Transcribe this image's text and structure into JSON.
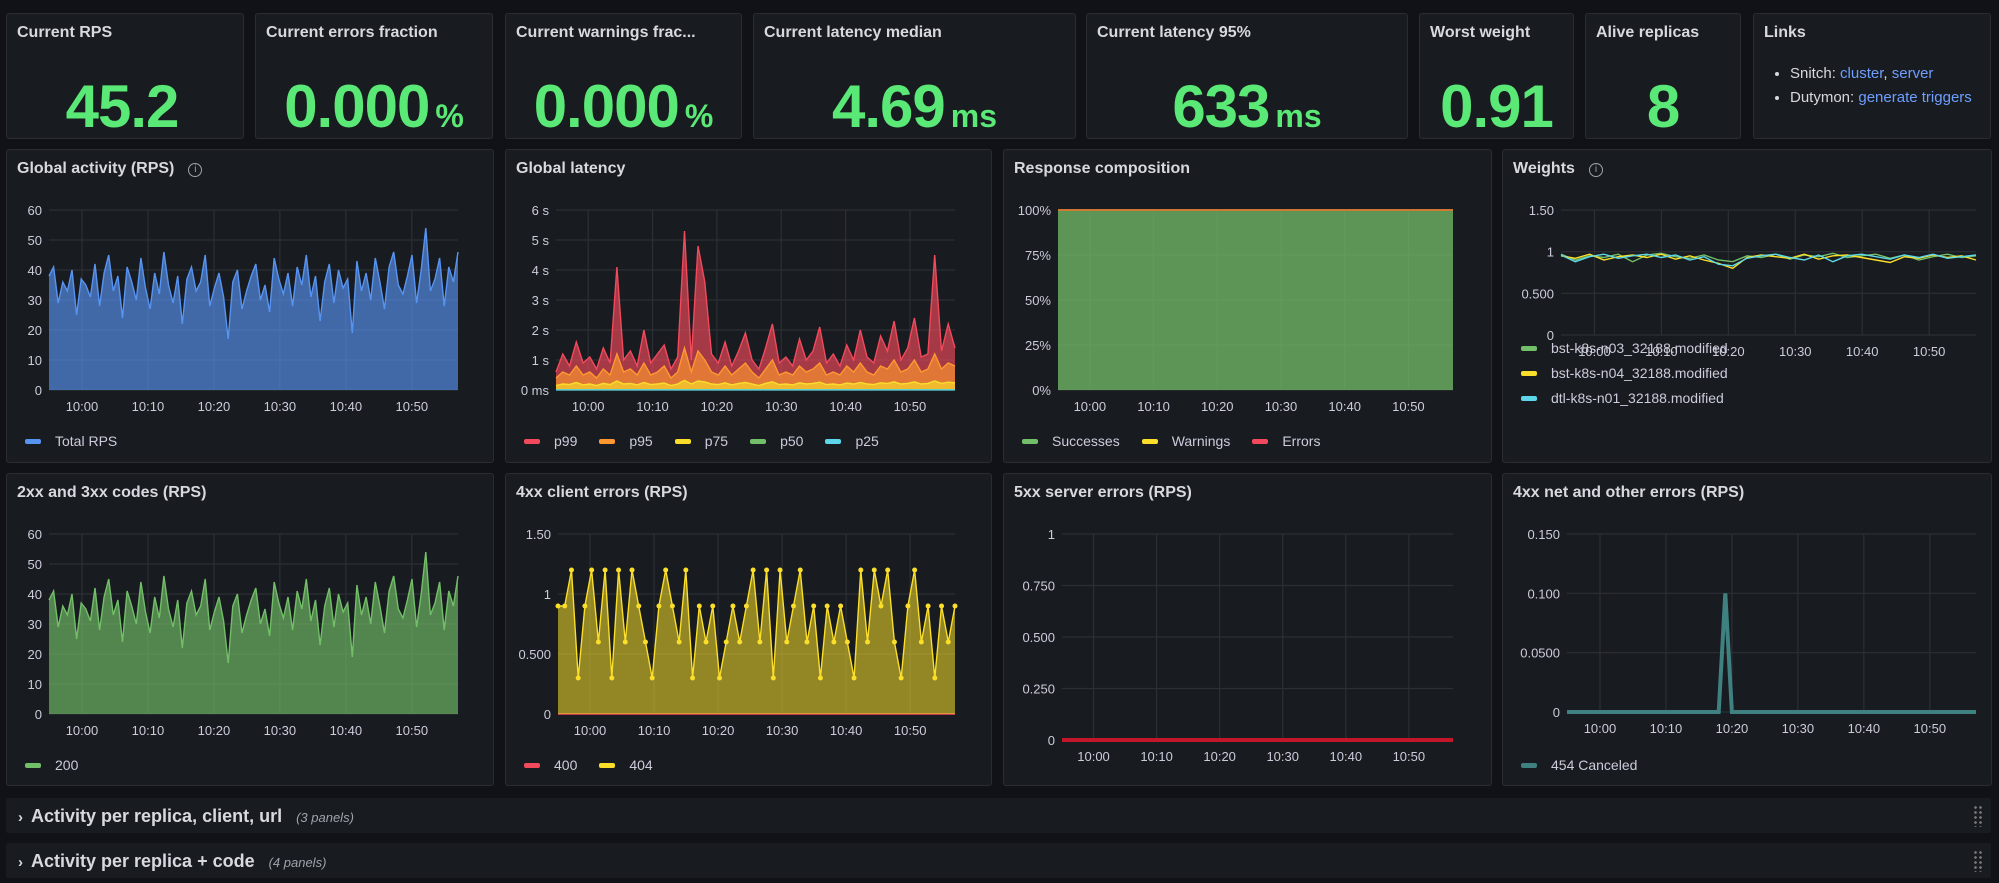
{
  "stats": [
    {
      "title": "Current RPS",
      "value": "45.2",
      "unit": ""
    },
    {
      "title": "Current errors fraction",
      "value": "0.000",
      "unit": "%"
    },
    {
      "title": "Current warnings frac...",
      "value": "0.000",
      "unit": "%"
    },
    {
      "title": "Current latency median",
      "value": "4.69",
      "unit": "ms"
    },
    {
      "title": "Current latency 95%",
      "value": "633",
      "unit": "ms"
    },
    {
      "title": "Worst weight",
      "value": "0.91",
      "unit": ""
    },
    {
      "title": "Alive replicas",
      "value": "8",
      "unit": ""
    }
  ],
  "links": {
    "title": "Links",
    "items": [
      {
        "label": "Snitch:",
        "links": [
          "cluster",
          "server"
        ]
      },
      {
        "label": "Dutymon:",
        "links": [
          "generate triggers"
        ]
      }
    ]
  },
  "colors": {
    "stat": "#5ae876",
    "background": "#111217",
    "panel": "#181b1f",
    "link": "#6e9fff"
  },
  "rows": [
    {
      "label": "Activity per replica, client, url",
      "count": "(3 panels)",
      "icon": "chevron-right-icon"
    },
    {
      "label": "Activity per replica + code",
      "count": "(4 panels)",
      "icon": "chevron-right-icon"
    }
  ],
  "chart_data": [
    {
      "title": "Global activity (RPS)",
      "info": true,
      "type": "area",
      "x_range": [
        "09:55",
        "10:57"
      ],
      "x_ticks": [
        "10:00",
        "10:10",
        "10:20",
        "10:30",
        "10:40",
        "10:50"
      ],
      "y_ticks": [
        "0",
        "10",
        "20",
        "30",
        "40",
        "50",
        "60"
      ],
      "ylim": [
        0,
        60
      ],
      "grid": true,
      "legend": "bottom",
      "series": [
        {
          "name": "Total RPS",
          "color": "#5794f2",
          "values": [
            38,
            41,
            29,
            36,
            33,
            40,
            25,
            37,
            35,
            31,
            42,
            28,
            39,
            45,
            33,
            38,
            24,
            41,
            36,
            30,
            44,
            34,
            27,
            39,
            32,
            46,
            35,
            29,
            38,
            22,
            37,
            41,
            33,
            36,
            45,
            28,
            34,
            39,
            31,
            17,
            36,
            40,
            27,
            33,
            38,
            42,
            30,
            35,
            26,
            44,
            37,
            32,
            39,
            28,
            41,
            35,
            45,
            31,
            38,
            23,
            36,
            42,
            29,
            40,
            34,
            37,
            19,
            43,
            33,
            39,
            30,
            44,
            36,
            27,
            41,
            46,
            35,
            32,
            38,
            45,
            29,
            40,
            54,
            33,
            37,
            44,
            28,
            41,
            36,
            46
          ]
        }
      ]
    },
    {
      "title": "Global latency",
      "type": "area",
      "x_range": [
        "09:55",
        "10:57"
      ],
      "x_ticks": [
        "10:00",
        "10:10",
        "10:20",
        "10:30",
        "10:40",
        "10:50"
      ],
      "y_ticks": [
        "0 ms",
        "1 s",
        "2 s",
        "3 s",
        "4 s",
        "5 s",
        "6 s"
      ],
      "ylim": [
        0,
        6
      ],
      "grid": true,
      "legend": "bottom",
      "series": [
        {
          "name": "p99",
          "color": "#f2495c",
          "values": [
            0.6,
            1.2,
            0.8,
            1.6,
            0.9,
            1.1,
            0.7,
            1.4,
            0.9,
            4.1,
            1.0,
            1.3,
            0.8,
            2.0,
            0.9,
            1.2,
            1.5,
            0.7,
            1.1,
            5.3,
            1.0,
            4.8,
            3.6,
            1.2,
            0.9,
            1.6,
            0.8,
            1.3,
            1.9,
            1.0,
            0.7,
            1.4,
            2.2,
            0.9,
            1.1,
            0.8,
            1.7,
            1.0,
            1.3,
            2.1,
            0.9,
            1.2,
            0.8,
            1.5,
            1.0,
            2.0,
            1.1,
            0.9,
            1.8,
            1.3,
            2.3,
            1.0,
            1.4,
            2.4,
            1.1,
            1.2,
            4.5,
            1.3,
            2.2,
            1.4
          ]
        },
        {
          "name": "p95",
          "color": "#ff9830",
          "values": [
            0.4,
            0.6,
            0.5,
            0.8,
            0.5,
            0.6,
            0.4,
            0.7,
            0.5,
            1.2,
            0.6,
            0.7,
            0.5,
            0.9,
            0.5,
            0.6,
            0.8,
            0.4,
            0.6,
            1.4,
            0.6,
            1.3,
            1.0,
            0.6,
            0.5,
            0.8,
            0.5,
            0.7,
            0.9,
            0.6,
            0.4,
            0.7,
            1.0,
            0.5,
            0.6,
            0.5,
            0.8,
            0.6,
            0.7,
            0.9,
            0.5,
            0.6,
            0.5,
            0.8,
            0.6,
            0.9,
            0.6,
            0.5,
            0.8,
            0.7,
            1.0,
            0.6,
            0.7,
            1.0,
            0.6,
            0.7,
            1.2,
            0.7,
            0.9,
            0.8
          ]
        },
        {
          "name": "p75",
          "color": "#fade2a",
          "values": [
            0.15,
            0.2,
            0.18,
            0.25,
            0.17,
            0.2,
            0.15,
            0.22,
            0.18,
            0.3,
            0.2,
            0.22,
            0.17,
            0.25,
            0.18,
            0.2,
            0.23,
            0.15,
            0.2,
            0.32,
            0.2,
            0.3,
            0.27,
            0.2,
            0.18,
            0.24,
            0.17,
            0.22,
            0.25,
            0.2,
            0.15,
            0.22,
            0.27,
            0.18,
            0.2,
            0.17,
            0.24,
            0.2,
            0.22,
            0.26,
            0.18,
            0.2,
            0.17,
            0.23,
            0.2,
            0.25,
            0.2,
            0.18,
            0.24,
            0.22,
            0.27,
            0.2,
            0.22,
            0.27,
            0.2,
            0.22,
            0.3,
            0.22,
            0.26,
            0.24
          ]
        },
        {
          "name": "p50",
          "color": "#73bf69",
          "values": [
            0.01,
            0.01,
            0.01,
            0.01,
            0.01,
            0.01,
            0.01,
            0.01,
            0.01,
            0.01,
            0.01,
            0.01
          ]
        },
        {
          "name": "p25",
          "color": "#5cd6e8",
          "values": [
            0.004,
            0.004,
            0.004,
            0.004,
            0.004,
            0.004,
            0.004,
            0.004,
            0.004,
            0.004,
            0.004,
            0.004
          ]
        }
      ]
    },
    {
      "title": "Response composition",
      "type": "area",
      "stacking": "percent",
      "x_range": [
        "09:55",
        "10:57"
      ],
      "x_ticks": [
        "10:00",
        "10:10",
        "10:20",
        "10:30",
        "10:40",
        "10:50"
      ],
      "y_ticks": [
        "0%",
        "25%",
        "50%",
        "75%",
        "100%"
      ],
      "ylim": [
        0,
        100
      ],
      "grid": true,
      "legend": "bottom",
      "series": [
        {
          "name": "Successes",
          "color": "#73bf69",
          "values": [
            100,
            100,
            100,
            100,
            100,
            100,
            100,
            100,
            100,
            100
          ]
        },
        {
          "name": "Warnings",
          "color": "#fade2a",
          "values": [
            0,
            0,
            0,
            0,
            0,
            0,
            0,
            0,
            0,
            0
          ]
        },
        {
          "name": "Errors",
          "color": "#f2495c",
          "values": [
            0,
            0,
            0,
            0,
            0,
            0,
            0,
            0,
            0,
            0
          ]
        }
      ]
    },
    {
      "title": "Weights",
      "info": true,
      "type": "line",
      "x_range": [
        "09:55",
        "10:57"
      ],
      "x_ticks": [
        "10:00",
        "10:10",
        "10:20",
        "10:30",
        "10:40",
        "10:50"
      ],
      "y_ticks": [
        "0",
        "0.500",
        "1",
        "1.50"
      ],
      "ylim": [
        0,
        1.5
      ],
      "grid": true,
      "legend": "bottom",
      "series": [
        {
          "name": "bst-k8s-n03_32188.modified",
          "color": "#73bf69",
          "values": [
            0.97,
            0.9,
            0.95,
            0.93,
            0.97,
            0.88,
            0.96,
            0.98,
            0.94,
            0.92,
            0.96,
            0.9,
            0.88,
            0.95,
            0.93,
            0.97,
            0.91,
            0.96,
            0.94,
            0.98,
            0.93,
            0.95,
            0.97,
            0.92,
            0.96,
            0.9,
            0.94,
            0.97,
            0.93,
            0.95
          ]
        },
        {
          "name": "bst-k8s-n04_32188.modified",
          "color": "#fade2a",
          "values": [
            0.95,
            0.92,
            0.97,
            0.9,
            0.94,
            0.96,
            0.93,
            0.97,
            0.91,
            0.95,
            0.9,
            0.86,
            0.8,
            0.93,
            0.96,
            0.94,
            0.92,
            0.97,
            0.91,
            0.95,
            0.96,
            0.93,
            0.9,
            0.87,
            0.94,
            0.92,
            0.96,
            0.93,
            0.95,
            0.9
          ]
        },
        {
          "name": "dtl-k8s-n01_32188.modified",
          "color": "#5cd6e8",
          "values": [
            0.96,
            0.88,
            0.94,
            0.97,
            0.92,
            0.95,
            0.97,
            0.93,
            0.96,
            0.9,
            0.94,
            0.85,
            0.83,
            0.92,
            0.95,
            0.97,
            0.93,
            0.9,
            0.96,
            0.88,
            0.95,
            0.97,
            0.94,
            0.91,
            0.96,
            0.93,
            0.97,
            0.92,
            0.94,
            0.96
          ]
        }
      ]
    },
    {
      "title": "2xx and 3xx codes (RPS)",
      "type": "area",
      "x_range": [
        "09:55",
        "10:57"
      ],
      "x_ticks": [
        "10:00",
        "10:10",
        "10:20",
        "10:30",
        "10:40",
        "10:50"
      ],
      "y_ticks": [
        "0",
        "10",
        "20",
        "30",
        "40",
        "50",
        "60"
      ],
      "ylim": [
        0,
        60
      ],
      "grid": true,
      "legend": "bottom",
      "series": [
        {
          "name": "200",
          "color": "#73bf69",
          "values": [
            38,
            41,
            29,
            36,
            33,
            40,
            25,
            37,
            35,
            31,
            42,
            28,
            39,
            45,
            33,
            38,
            24,
            41,
            36,
            30,
            44,
            34,
            27,
            39,
            32,
            46,
            35,
            29,
            38,
            22,
            37,
            41,
            33,
            36,
            45,
            28,
            34,
            39,
            31,
            17,
            36,
            40,
            27,
            33,
            38,
            42,
            30,
            35,
            26,
            44,
            37,
            32,
            39,
            28,
            41,
            35,
            45,
            31,
            38,
            23,
            36,
            42,
            29,
            40,
            34,
            37,
            19,
            43,
            33,
            39,
            30,
            44,
            36,
            27,
            41,
            46,
            35,
            32,
            38,
            45,
            29,
            40,
            54,
            33,
            37,
            44,
            28,
            41,
            36,
            46
          ]
        }
      ]
    },
    {
      "title": "4xx client errors (RPS)",
      "type": "points",
      "x_range": [
        "09:55",
        "10:57"
      ],
      "x_ticks": [
        "10:00",
        "10:10",
        "10:20",
        "10:30",
        "10:40",
        "10:50"
      ],
      "y_ticks": [
        "0",
        "0.500",
        "1",
        "1.50"
      ],
      "ylim": [
        0,
        1.5
      ],
      "grid": true,
      "legend": "bottom",
      "series": [
        {
          "name": "400",
          "color": "#f2495c",
          "values": [
            0,
            0,
            0,
            0,
            0,
            0,
            0,
            0,
            0,
            0,
            0,
            0
          ]
        },
        {
          "name": "404",
          "color": "#fade2a",
          "values": [
            0.9,
            0.9,
            1.2,
            0.3,
            0.9,
            1.2,
            0.6,
            1.2,
            0.3,
            1.2,
            0.6,
            1.2,
            0.9,
            0.6,
            0.3,
            0.9,
            1.2,
            0.9,
            0.6,
            1.2,
            0.3,
            0.9,
            0.6,
            0.9,
            0.3,
            0.6,
            0.9,
            0.6,
            0.9,
            1.2,
            0.6,
            1.2,
            0.3,
            1.2,
            0.6,
            0.9,
            1.2,
            0.6,
            0.9,
            0.3,
            0.9,
            0.6,
            0.9,
            0.6,
            0.3,
            1.2,
            0.6,
            1.2,
            0.9,
            1.2,
            0.6,
            0.3,
            0.9,
            1.2,
            0.6,
            0.9,
            0.3,
            0.9,
            0.6,
            0.9
          ]
        }
      ]
    },
    {
      "title": "5xx server errors (RPS)",
      "type": "line",
      "x_range": [
        "09:55",
        "10:57"
      ],
      "x_ticks": [
        "10:00",
        "10:10",
        "10:20",
        "10:30",
        "10:40",
        "10:50"
      ],
      "y_ticks": [
        "0",
        "0.250",
        "0.500",
        "0.750",
        "1"
      ],
      "ylim": [
        0,
        1
      ],
      "grid": true,
      "legend": "none",
      "series": [
        {
          "color": "#c4162a",
          "values": [
            0,
            0,
            0,
            0,
            0,
            0,
            0,
            0,
            0,
            0
          ]
        }
      ]
    },
    {
      "title": "4xx net and other errors (RPS)",
      "type": "line",
      "x_range": [
        "09:55",
        "10:57"
      ],
      "x_ticks": [
        "10:00",
        "10:10",
        "10:20",
        "10:30",
        "10:40",
        "10:50"
      ],
      "y_ticks": [
        "0",
        "0.0500",
        "0.100",
        "0.150"
      ],
      "ylim": [
        0,
        0.15
      ],
      "grid": true,
      "legend": "bottom",
      "series": [
        {
          "name": "454 Canceled",
          "color": "#3f8081",
          "values": [
            0,
            0,
            0,
            0,
            0,
            0,
            0,
            0,
            0,
            0,
            0,
            0,
            0,
            0,
            0,
            0,
            0,
            0,
            0,
            0,
            0,
            0,
            0,
            0,
            0.1,
            0,
            0,
            0,
            0,
            0,
            0,
            0,
            0,
            0,
            0,
            0,
            0,
            0,
            0,
            0,
            0,
            0,
            0,
            0,
            0,
            0,
            0,
            0,
            0,
            0,
            0,
            0,
            0,
            0,
            0,
            0,
            0,
            0,
            0,
            0,
            0,
            0,
            0
          ]
        }
      ]
    }
  ]
}
